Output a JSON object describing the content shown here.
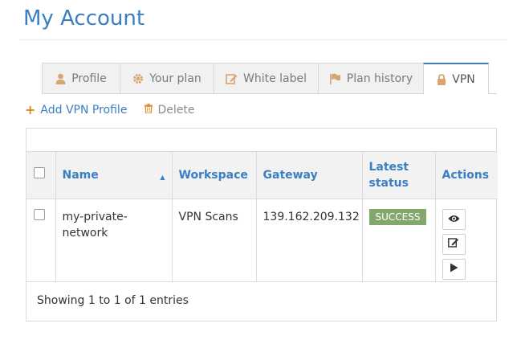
{
  "page": {
    "title": "My Account"
  },
  "tabs": [
    {
      "label": "Profile",
      "icon": "user-icon"
    },
    {
      "label": "Your plan",
      "icon": "gear-icon"
    },
    {
      "label": "White label",
      "icon": "edit-icon"
    },
    {
      "label": "Plan history",
      "icon": "flag-icon"
    },
    {
      "label": "VPN",
      "icon": "lock-icon",
      "active": true
    }
  ],
  "toolbar": {
    "add_label": "Add VPN Profile",
    "delete_label": "Delete"
  },
  "table": {
    "headers": {
      "name": "Name",
      "workspace": "Workspace",
      "gateway": "Gateway",
      "status_line1": "Latest",
      "status_line2": "status",
      "actions": "Actions"
    },
    "rows": [
      {
        "name_line1": "my-private-",
        "name_line2": "network",
        "workspace": "VPN Scans",
        "gateway": "139.162.209.132",
        "status": "SUCCESS"
      }
    ],
    "footer": "Showing 1 to 1 of 1 entries"
  },
  "colors": {
    "accent": "#3a7fc1",
    "tab_icon": "#d8a56f",
    "success_badge": "#83a86b",
    "add_plus": "#e08b2c"
  }
}
